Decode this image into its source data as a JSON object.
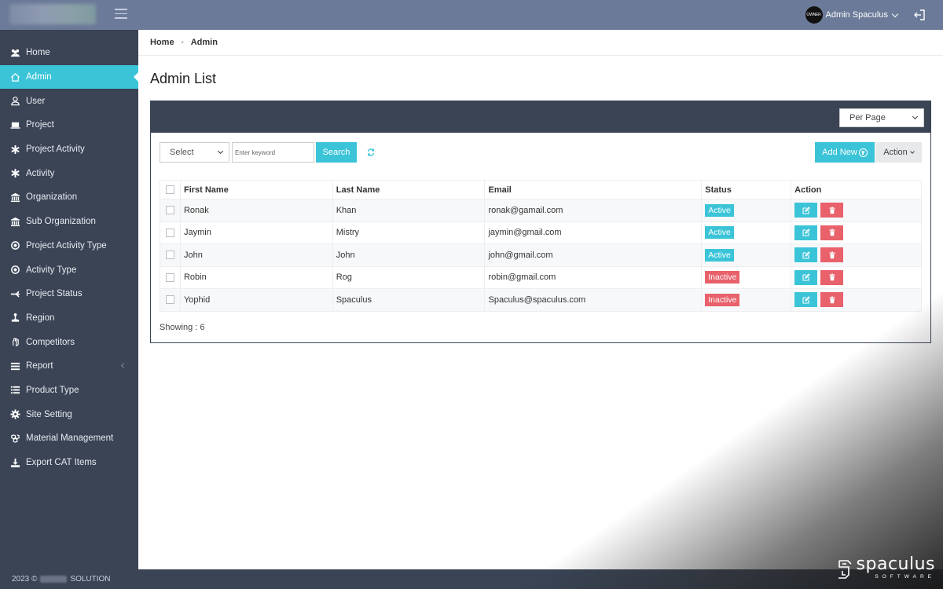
{
  "header": {
    "avatar_text": "OWNER",
    "user_name": "Admin Spaculus"
  },
  "sidebar": {
    "items": [
      {
        "label": "Home",
        "icon": "users-icon"
      },
      {
        "label": "Admin",
        "icon": "home-icon",
        "active": true
      },
      {
        "label": "User",
        "icon": "user-icon"
      },
      {
        "label": "Project",
        "icon": "laptop-icon"
      },
      {
        "label": "Project Activity",
        "icon": "asterisk-icon"
      },
      {
        "label": "Activity",
        "icon": "asterisk-icon"
      },
      {
        "label": "Organization",
        "icon": "bank-icon"
      },
      {
        "label": "Sub Organization",
        "icon": "bank-icon"
      },
      {
        "label": "Project Activity Type",
        "icon": "target-icon"
      },
      {
        "label": "Activity Type",
        "icon": "target-icon"
      },
      {
        "label": "Project Status",
        "icon": "plane-icon"
      },
      {
        "label": "Region",
        "icon": "pin-icon"
      },
      {
        "label": "Competitors",
        "icon": "hand-icon"
      },
      {
        "label": "Report",
        "icon": "list-icon",
        "has_submenu": true
      },
      {
        "label": "Product Type",
        "icon": "list-alt-icon"
      },
      {
        "label": "Site Setting",
        "icon": "gear-icon"
      },
      {
        "label": "Material Management",
        "icon": "cubes-icon"
      },
      {
        "label": "Export CAT Items",
        "icon": "download-icon"
      }
    ],
    "footer": {
      "year": "2023 ©",
      "company_suffix": "SOLUTION"
    }
  },
  "breadcrumb": {
    "home": "Home",
    "separator": "•",
    "current": "Admin"
  },
  "page": {
    "title": "Admin List"
  },
  "panel": {
    "per_page_label": "Per Page",
    "filter_select": "Select",
    "keyword_placeholder": "Enter keyword",
    "search_label": "Search",
    "add_new_label": "Add New",
    "action_label": "Action",
    "columns": [
      "First Name",
      "Last Name",
      "Email",
      "Status",
      "Action"
    ],
    "rows": [
      {
        "first": "Ronak",
        "last": "Khan",
        "email": "ronak@gamail.com",
        "status": "Active"
      },
      {
        "first": "Jaymin",
        "last": "Mistry",
        "email": "jaymin@gmail.com",
        "status": "Active"
      },
      {
        "first": "John",
        "last": "John",
        "email": "john@gmail.com",
        "status": "Active"
      },
      {
        "first": "Robin",
        "last": "Rog",
        "email": "robin@gmail.com",
        "status": "Inactive"
      },
      {
        "first": "Yophid",
        "last": "Spaculus",
        "email": "Spaculus@spaculus.com",
        "status": "Inactive"
      }
    ],
    "showing": "Showing : 6"
  },
  "watermark": {
    "name": "spaculus",
    "sub": "SOFTWARE"
  },
  "colors": {
    "accent": "#3bc4d8",
    "danger": "#e8616b",
    "sidebar": "#3a4455",
    "topbar": "#6b7a98"
  }
}
